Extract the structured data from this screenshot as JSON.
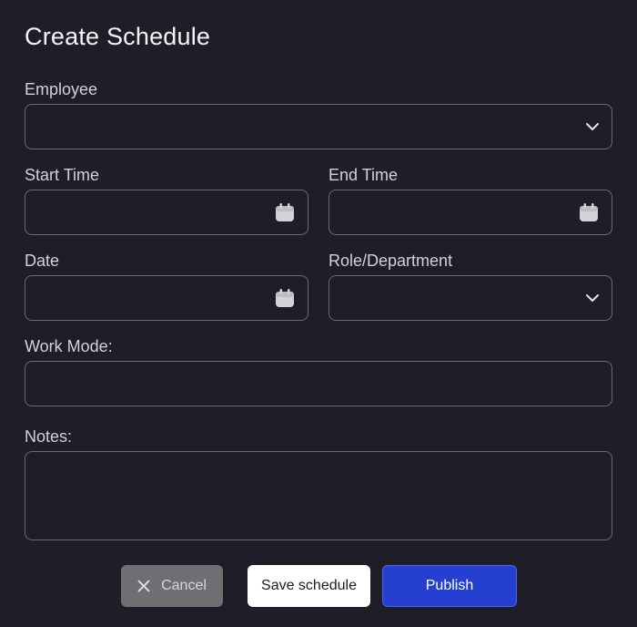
{
  "modal": {
    "title": "Create Schedule"
  },
  "fields": {
    "employee": {
      "label": "Employee",
      "value": ""
    },
    "start_time": {
      "label": "Start Time",
      "value": ""
    },
    "end_time": {
      "label": "End Time",
      "value": ""
    },
    "date": {
      "label": "Date",
      "value": ""
    },
    "role_department": {
      "label": "Role/Department",
      "value": ""
    },
    "work_mode": {
      "label": "Work Mode:",
      "value": ""
    },
    "notes": {
      "label": "Notes:",
      "value": ""
    }
  },
  "buttons": {
    "cancel": "Cancel",
    "save": "Save schedule",
    "publish": "Publish"
  },
  "icons": {
    "dropdown": "chevron-down-icon",
    "calendar": "calendar-icon",
    "close": "close-icon"
  },
  "colors": {
    "background": "#1e1e28",
    "field_border": "#6a6a74",
    "primary": "#2540d0",
    "cancel_bg": "#6f6f73"
  }
}
